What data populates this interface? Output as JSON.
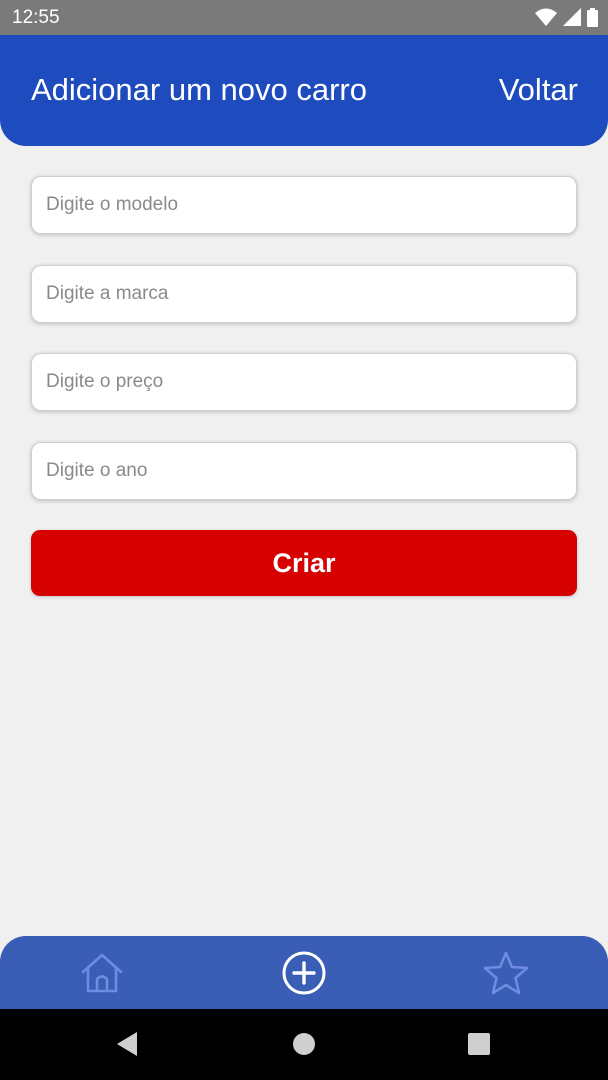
{
  "status_bar": {
    "time": "12:55"
  },
  "header": {
    "title": "Adicionar um novo carro",
    "back_label": "Voltar"
  },
  "form": {
    "model_placeholder": "Digite o modelo",
    "brand_placeholder": "Digite a marca",
    "price_placeholder": "Digite o preço",
    "year_placeholder": "Digite o ano",
    "submit_label": "Criar"
  },
  "bottom_nav": {
    "items": [
      {
        "icon": "home-icon",
        "active": false
      },
      {
        "icon": "plus-circle-icon",
        "active": true
      },
      {
        "icon": "star-icon",
        "active": false
      }
    ]
  },
  "colors": {
    "header": "#1e4bbd",
    "bottom_nav": "#3a5db5",
    "submit": "#d60000",
    "background": "#f0f0f0"
  }
}
